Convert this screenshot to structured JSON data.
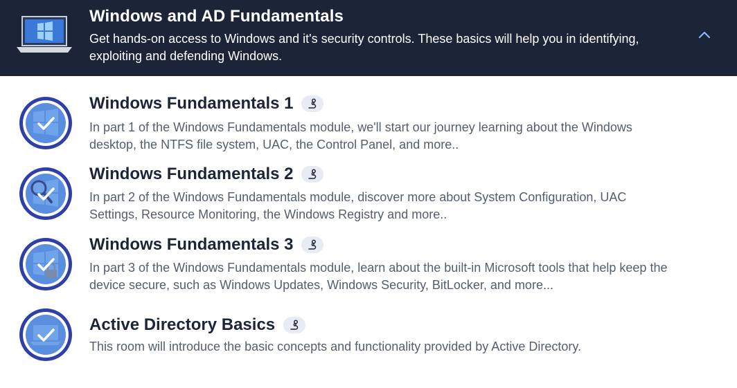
{
  "module": {
    "title": "Windows and AD Fundamentals",
    "description": "Get hands-on access to Windows and it's security controls. These basics will help you in identifying, exploiting and defending Windows.",
    "icon": "laptop-windows-icon",
    "collapse_icon": "chevron-up-icon"
  },
  "rooms": [
    {
      "title": "Windows Fundamentals 1",
      "description": "In part 1 of the Windows Fundamentals module, we'll start our journey learning about the Windows desktop, the NTFS file system, UAC, the Control Panel, and more..",
      "status_icon": "check-icon",
      "tag_icon": "path-icon"
    },
    {
      "title": "Windows Fundamentals 2",
      "description": "In part 2 of the Windows Fundamentals module, discover more about System Configuration, UAC Settings, Resource Monitoring, the Windows Registry and more..",
      "status_icon": "check-icon",
      "tag_icon": "path-icon"
    },
    {
      "title": "Windows Fundamentals 3",
      "description": "In part 3 of the Windows Fundamentals module, learn about the built-in Microsoft tools that help keep the device secure, such as Windows Updates, Windows Security, BitLocker, and more...",
      "status_icon": "check-icon",
      "tag_icon": "path-icon"
    },
    {
      "title": "Active Directory Basics",
      "description": "This room will introduce the basic concepts and functionality provided by Active Directory.",
      "status_icon": "check-icon",
      "tag_icon": "path-icon"
    }
  ],
  "colors": {
    "header_bg": "#1c2538",
    "badge_ring": "#2f3fa8",
    "badge_fill": "#5a8fe0",
    "accent": "#88b6ff",
    "text_muted": "#545e6f"
  }
}
